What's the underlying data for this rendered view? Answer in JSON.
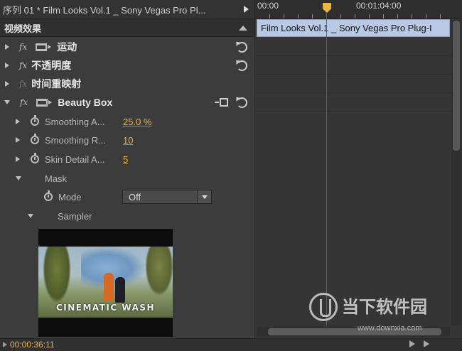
{
  "sequence_header": {
    "title": "序列 01 * Film Looks Vol.1 _ Sony Vegas Pro Pl..."
  },
  "effects_panel": {
    "title": "视频效果",
    "fx_label": "fx",
    "effects": [
      {
        "name": "运动"
      },
      {
        "name": "不透明度"
      },
      {
        "name": "时间重映射"
      },
      {
        "name": "Beauty Box"
      }
    ],
    "params": [
      {
        "label": "Smoothing A...",
        "value": "25.0 %"
      },
      {
        "label": "Smoothing R...",
        "value": "10"
      },
      {
        "label": "Skin Detail A...",
        "value": "5"
      }
    ],
    "mask_label": "Mask",
    "mode_label": "Mode",
    "mode_value": "Off",
    "sampler_label": "Sampler",
    "thumbnail_caption": "CINEMATIC WASH"
  },
  "timeline": {
    "ruler_labels": [
      "00:00",
      "00:01:04:00"
    ],
    "clip_name": "Film Looks Vol.1 _ Sony Vegas Pro Plug-I"
  },
  "footer": {
    "timecode": "00:00:36:11"
  },
  "watermark": {
    "name": "当下软件园",
    "url": "www.downxia.com"
  },
  "colors": {
    "accent": "#e8b44a",
    "playhead": "#c0392b",
    "clip": "#b8c9e3"
  }
}
